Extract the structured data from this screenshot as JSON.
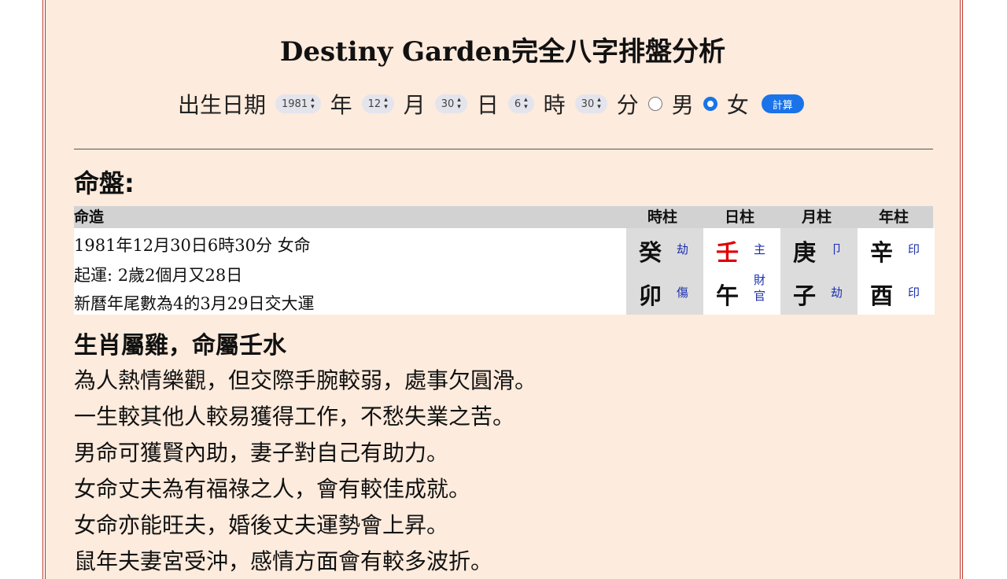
{
  "title": "Destiny Garden完全八字排盤分析",
  "form": {
    "birth_label": "出生日期",
    "year_value": "1981",
    "year_label": "年",
    "month_value": "12",
    "month_label": "月",
    "day_value": "30",
    "day_label": "日",
    "hour_value": "6",
    "hour_label": "時",
    "minute_value": "30",
    "minute_label": "分",
    "male_label": "男",
    "female_label": "女",
    "gender_selected": "女",
    "calc_label": "計算"
  },
  "chart_heading": "命盤:",
  "table": {
    "header_label": "命造",
    "columns": [
      "時柱",
      "日柱",
      "月柱",
      "年柱"
    ],
    "info_lines": [
      "1981年12月30日6時30分 女命",
      "起運: 2歲2個月又28日",
      "新曆年尾數為4的3月29日交大運"
    ],
    "pillars": [
      {
        "stem": "癸",
        "stem_god": "劫",
        "branch": "卯",
        "branch_god": "傷"
      },
      {
        "stem": "壬",
        "stem_god": "主",
        "branch": "午",
        "branch_god_1": "財",
        "branch_god_2": "官"
      },
      {
        "stem": "庚",
        "stem_god": "卩",
        "branch": "子",
        "branch_god": "劫"
      },
      {
        "stem": "辛",
        "stem_god": "印",
        "branch": "酉",
        "branch_god": "印"
      }
    ],
    "colors": {
      "day_master": "#e00000",
      "ten_gods": "#1a2fb0",
      "accent": "#1a73e8"
    }
  },
  "zodiac_heading": "生肖屬雞，命屬壬水",
  "description": [
    "為人熱情樂觀，但交際手腕較弱，處事欠圓滑。",
    "一生較其他人較易獲得工作，不愁失業之苦。",
    "男命可獲賢內助，妻子對自己有助力。",
    "女命丈夫為有福祿之人，會有較佳成就。",
    "女命亦能旺夫，婚後丈夫運勢會上昇。",
    "鼠年夫妻宮受沖，感情方面會有較多波折。"
  ]
}
